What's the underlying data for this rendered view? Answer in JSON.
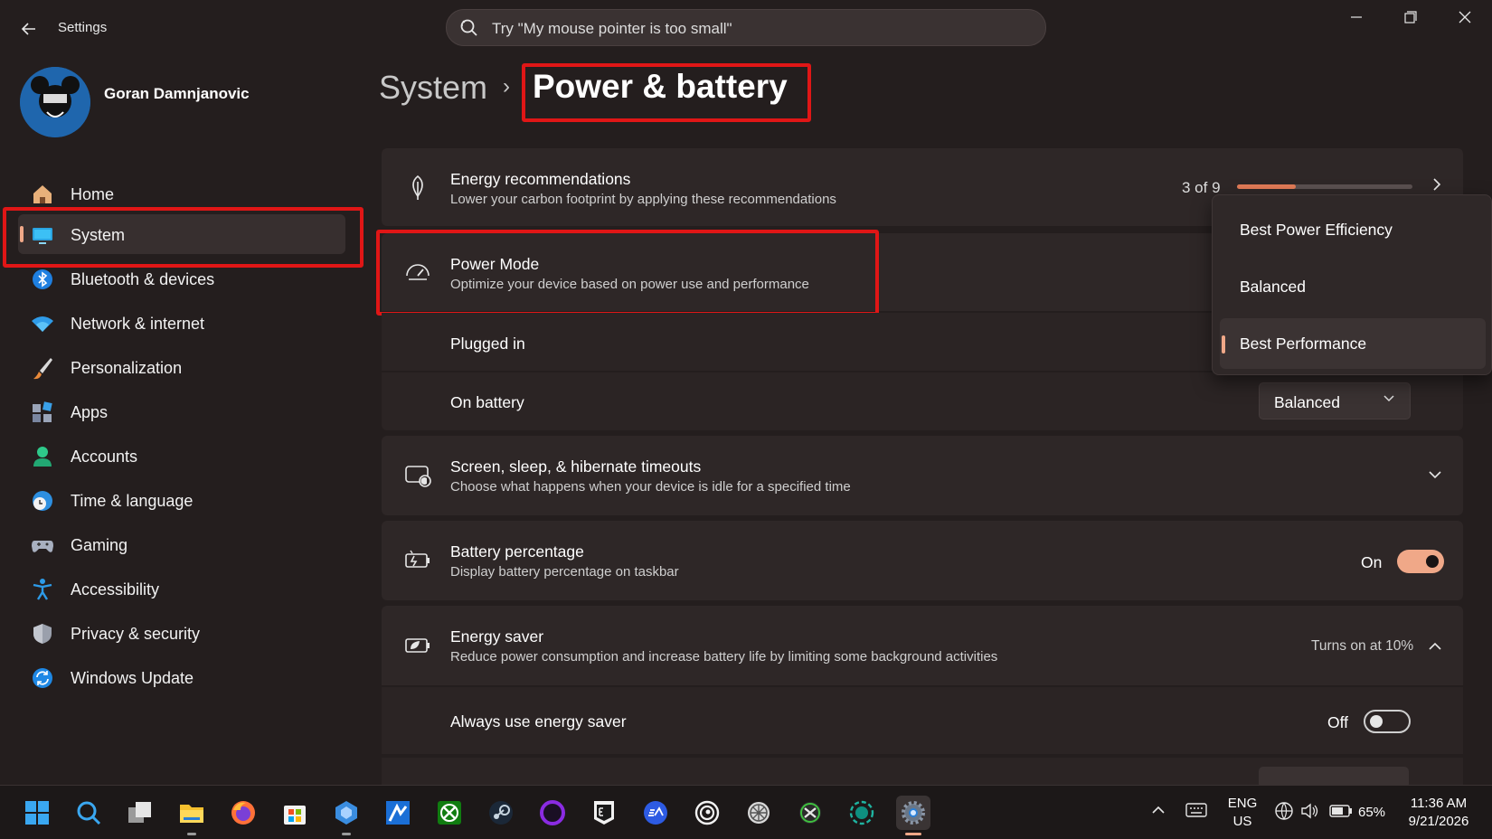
{
  "window": {
    "title": "Settings",
    "search_placeholder": "Try \"My mouse pointer is too small\""
  },
  "user": {
    "name": "Goran Damnjanovic"
  },
  "sidebar": {
    "items": [
      {
        "label": "Home",
        "icon": "home-icon"
      },
      {
        "label": "System",
        "icon": "monitor-icon"
      },
      {
        "label": "Bluetooth & devices",
        "icon": "bluetooth-icon"
      },
      {
        "label": "Network & internet",
        "icon": "wifi-icon"
      },
      {
        "label": "Personalization",
        "icon": "brush-icon"
      },
      {
        "label": "Apps",
        "icon": "apps-icon"
      },
      {
        "label": "Accounts",
        "icon": "person-icon"
      },
      {
        "label": "Time & language",
        "icon": "globe-clock-icon"
      },
      {
        "label": "Gaming",
        "icon": "gamepad-icon"
      },
      {
        "label": "Accessibility",
        "icon": "accessibility-icon"
      },
      {
        "label": "Privacy & security",
        "icon": "shield-icon"
      },
      {
        "label": "Windows Update",
        "icon": "update-icon"
      }
    ]
  },
  "breadcrumb": {
    "parent": "System",
    "separator": "›",
    "current": "Power & battery"
  },
  "energy_recommendations": {
    "title": "Energy recommendations",
    "subtitle": "Lower your carbon footprint by applying these recommendations",
    "count": "3 of 9",
    "progress": 0.333
  },
  "power_mode": {
    "title": "Power Mode",
    "subtitle": "Optimize your device based on power use and performance",
    "plugged_in_label": "Plugged in",
    "on_battery_label": "On battery",
    "on_battery_value": "Balanced",
    "options": [
      "Best Power Efficiency",
      "Balanced",
      "Best Performance"
    ],
    "selected_option": "Best Performance"
  },
  "screen_sleep": {
    "title": "Screen, sleep, & hibernate timeouts",
    "subtitle": "Choose what happens when your device is idle for a specified time"
  },
  "battery_percentage": {
    "title": "Battery percentage",
    "subtitle": "Display battery percentage on taskbar",
    "state": "On"
  },
  "energy_saver": {
    "title": "Energy saver",
    "subtitle": "Reduce power consumption and increase battery life by limiting some background activities",
    "status": "Turns on at 10%",
    "always_label": "Always use energy saver",
    "always_state": "Off"
  },
  "taskbar": {
    "apps": [
      "windows-start-icon",
      "search-icon",
      "task-view-icon",
      "file-explorer-icon",
      "firefox-icon",
      "microsoft-store-icon",
      "app-icon",
      "affinity-icon",
      "xbox-icon",
      "steam-icon",
      "circle-app-icon",
      "epic-games-icon",
      "ea-icon",
      "ubisoft-icon",
      "wheel-app-icon",
      "xbox-app-icon",
      "hexagon-app-icon",
      "settings-icon"
    ],
    "language": "ENG",
    "region": "US",
    "battery": "65%",
    "time": "11:36 AM",
    "date": "9/21/2026"
  },
  "colors": {
    "accent": "#f0a888",
    "progress_fill": "#e07a56",
    "highlight_box": "#e01616",
    "background": "#241e1e",
    "card": "#2e2727"
  }
}
